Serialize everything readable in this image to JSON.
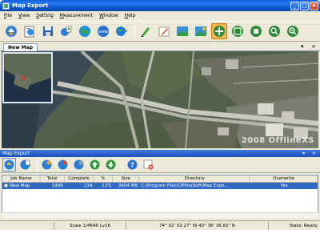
{
  "window": {
    "title": "Map Export"
  },
  "menu": {
    "items": [
      {
        "accel": "F",
        "rest": "ile"
      },
      {
        "accel": "V",
        "rest": "iew"
      },
      {
        "accel": "S",
        "rest": "etting"
      },
      {
        "accel": "M",
        "rest": "easurement"
      },
      {
        "accel": "W",
        "rest": "indow"
      },
      {
        "accel": "H",
        "rest": "elp"
      }
    ]
  },
  "toolbar": {
    "icons": [
      "connect-icon",
      "open-icon",
      "save-icon",
      "export-icon",
      "globe-icon",
      "www-icon",
      "maptype-icon",
      "draw-icon",
      "pencil-icon",
      "image-icon",
      "image-export-icon",
      "pan-icon",
      "zoom-fit-icon",
      "zoom-window-icon",
      "zoom-in-icon",
      "zoom-out-icon"
    ]
  },
  "tabs": {
    "active": "New Map",
    "arrow": "▾",
    "close": "×"
  },
  "map": {
    "watermark": "2008 OfflineXS"
  },
  "panel": {
    "title": "Map Export",
    "pin": "▾",
    "close": "×",
    "toolbar_icons": [
      "add-task-icon",
      "edit-task-icon",
      "start-icon",
      "pause-icon",
      "stop-icon",
      "move-up-icon",
      "move-down-icon",
      "help-icon",
      "delete-icon"
    ]
  },
  "table": {
    "headers": [
      "Job Name",
      "Total",
      "Complete",
      "%",
      "Size",
      "Directory",
      "Overwrite"
    ],
    "rows": [
      {
        "name": "New Map",
        "total": "1999",
        "complete": "234",
        "percent": "11%",
        "size": "3604 MB",
        "directory": "C:\\Program Files\\OfflineSoft\\Map Expo...",
        "overwrite": "Yes"
      }
    ]
  },
  "status": {
    "scale": "Scale 1/4646  Lv16",
    "coords": "74°  02'  02.27\"   W     40°  36'  36.82\"   N",
    "state": "State: Ready"
  },
  "colors": {
    "accent": "#316ac5",
    "titlebar": "#0a55c9",
    "active_tool": "#f6b84a"
  }
}
